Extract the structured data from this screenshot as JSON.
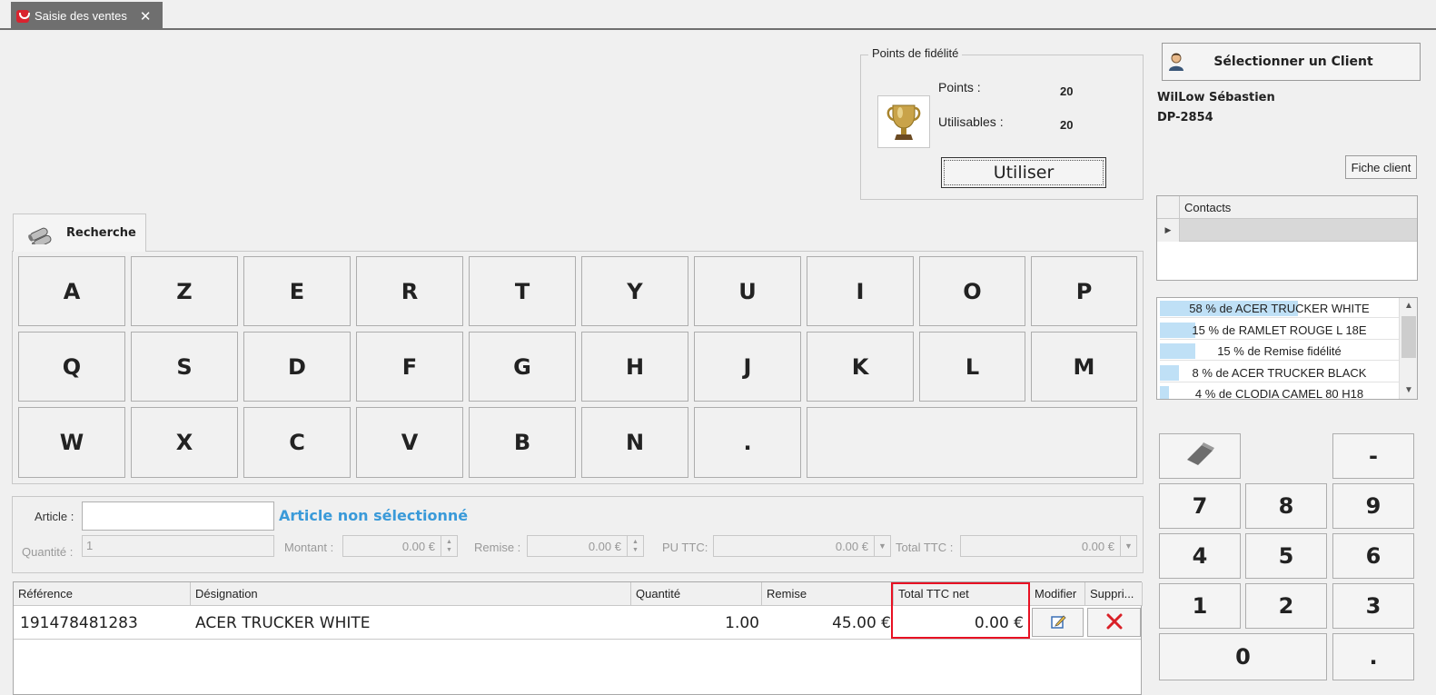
{
  "tab": {
    "title": "Saisie des ventes",
    "close": "✕"
  },
  "fidelite": {
    "group_title": "Points de fidélité",
    "points_label": "Points :",
    "points_value": "20",
    "utilisables_label": "Utilisables :",
    "utilisables_value": "20",
    "utiliser_label": "Utiliser"
  },
  "client": {
    "select_label": "Sélectionner un Client",
    "name": "WilLow Sébastien",
    "code": "DP-2854",
    "fiche_label": "Fiche client"
  },
  "contacts": {
    "header": "Contacts"
  },
  "top_products": [
    {
      "label": "58 % de ACER TRUCKER WHITE",
      "percent": 58
    },
    {
      "label": "15 % de RAMLET ROUGE L 18E",
      "percent": 15
    },
    {
      "label": "15 % de Remise fidélité",
      "percent": 15
    },
    {
      "label": "8 % de ACER TRUCKER BLACK",
      "percent": 8
    },
    {
      "label": "4 % de CLODIA CAMEL 80 H18",
      "percent": 4
    }
  ],
  "keypad": {
    "minus": "-",
    "k7": "7",
    "k8": "8",
    "k9": "9",
    "k4": "4",
    "k5": "5",
    "k6": "6",
    "k1": "1",
    "k2": "2",
    "k3": "3",
    "k0": "0",
    "dot": "."
  },
  "recherche": {
    "tab_label": "Recherche",
    "row1": [
      "A",
      "Z",
      "E",
      "R",
      "T",
      "Y",
      "U",
      "I",
      "O",
      "P"
    ],
    "row2": [
      "Q",
      "S",
      "D",
      "F",
      "G",
      "H",
      "J",
      "K",
      "L",
      "M"
    ],
    "row3": [
      "W",
      "X",
      "C",
      "V",
      "B",
      "N",
      "."
    ]
  },
  "article": {
    "article_label": "Article :",
    "status": "Article non sélectionné",
    "quantite_label": "Quantité :",
    "quantite_value": "1",
    "montant_label": "Montant :",
    "montant_value": "0.00 €",
    "remise_label": "Remise :",
    "remise_value": "0.00 €",
    "pu_label": "PU TTC:",
    "pu_value": "0.00 €",
    "total_label": "Total TTC :",
    "total_value": "0.00 €"
  },
  "grid": {
    "columns": {
      "reference": "Référence",
      "designation": "Désignation",
      "quantite": "Quantité",
      "remise": "Remise",
      "total": "Total TTC net",
      "modifier": "Modifier",
      "supprimer": "Suppri..."
    },
    "rows": [
      {
        "reference": "191478481283",
        "designation": "ACER TRUCKER WHITE",
        "quantite": "1.00",
        "remise": "45.00 €",
        "total": "0.00 €"
      }
    ]
  },
  "colors": {
    "accent_text": "#3a9ad9",
    "bar": "#bfe0f6",
    "highlight": "#e81123",
    "delete": "#d92027"
  }
}
